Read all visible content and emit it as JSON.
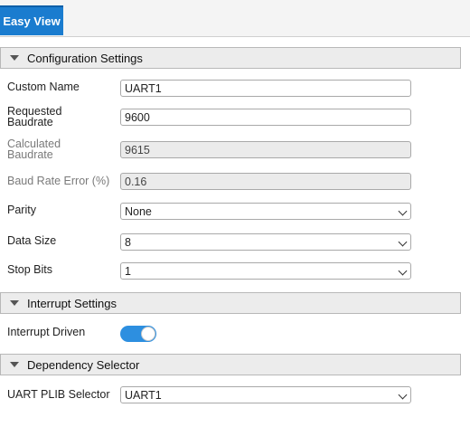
{
  "tabs": [
    {
      "label": "Easy View"
    }
  ],
  "sections": {
    "configuration": {
      "title": "Configuration Settings"
    },
    "interrupt": {
      "title": "Interrupt Settings"
    },
    "dependency": {
      "title": "Dependency Selector"
    }
  },
  "config": {
    "custom_name": {
      "label": "Custom Name",
      "value": "UART1"
    },
    "requested_baudrate": {
      "label_line1": "Requested",
      "label_line2": "Baudrate",
      "value": "9600"
    },
    "calculated_baudrate": {
      "label_line1": "Calculated",
      "label_line2": "Baudrate",
      "value": "9615"
    },
    "baud_rate_error": {
      "label": "Baud Rate Error (%)",
      "value": "0.16"
    },
    "parity": {
      "label": "Parity",
      "value": "None"
    },
    "data_size": {
      "label": "Data Size",
      "value": "8"
    },
    "stop_bits": {
      "label": "Stop Bits",
      "value": "1"
    }
  },
  "interrupt": {
    "interrupt_driven": {
      "label": "Interrupt Driven",
      "enabled": true
    }
  },
  "dependency": {
    "plib_selector": {
      "label": "UART PLIB Selector",
      "value": "UART1"
    }
  },
  "colors": {
    "accent": "#1a7ccf",
    "toggle_on": "#2d8fe0",
    "header_bg": "#ececec"
  }
}
